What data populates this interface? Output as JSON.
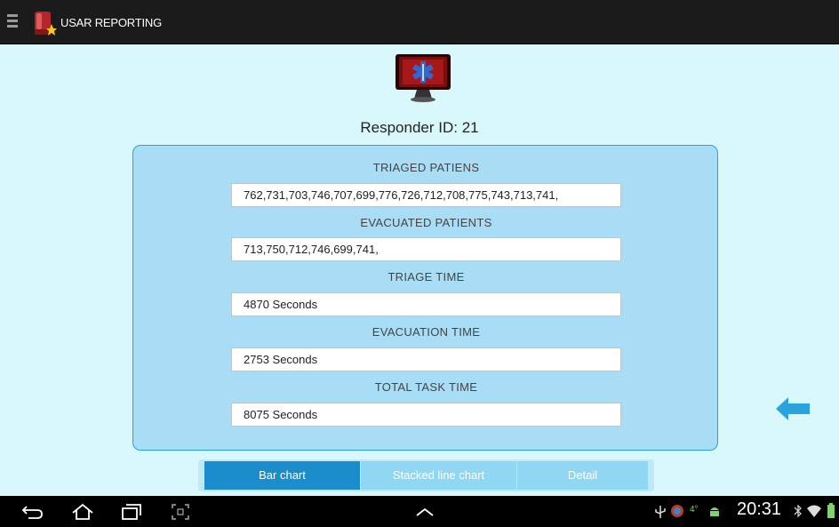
{
  "app": {
    "title": "USAR REPORTING"
  },
  "header": {
    "responder_label": "Responder ID: 21"
  },
  "fields": [
    {
      "label": "TRIAGED PATIENS",
      "value": "762,731,703,746,707,699,776,726,712,708,775,743,713,741,"
    },
    {
      "label": "EVACUATED PATIENTS",
      "value": "713,750,712,746,699,741,"
    },
    {
      "label": "TRIAGE TIME",
      "value": "4870 Seconds"
    },
    {
      "label": "EVACUATION TIME",
      "value": "2753 Seconds"
    },
    {
      "label": "TOTAL TASK TIME",
      "value": "8075 Seconds"
    }
  ],
  "tabs": [
    {
      "label": "Bar chart",
      "active": true
    },
    {
      "label": "Stacked line chart",
      "active": false
    },
    {
      "label": "Detail",
      "active": false
    }
  ],
  "status_bar": {
    "time": "20:31",
    "temperature": "4°"
  },
  "colors": {
    "background": "#d8f8fc",
    "panel": "#a9ddf6",
    "accent": "#1b8ccc"
  }
}
